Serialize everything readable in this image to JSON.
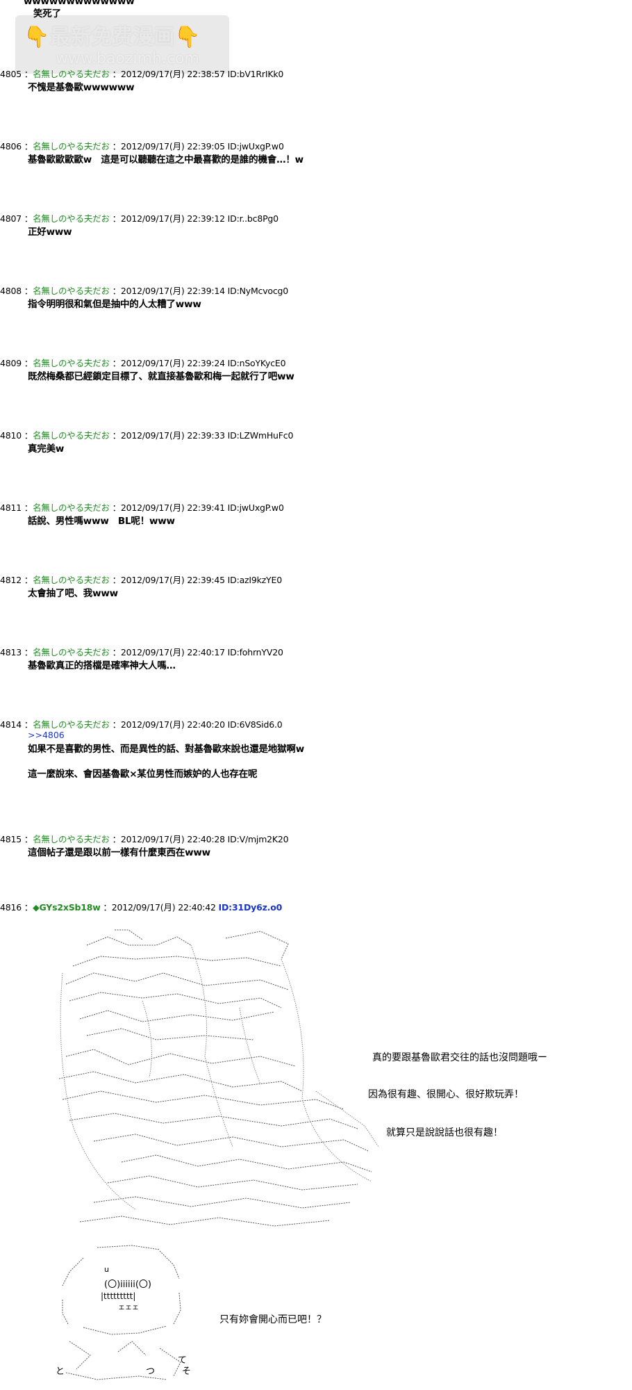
{
  "watermark": {
    "title": "最新免费漫画",
    "url": "www.baozimh.com",
    "hand": "👇"
  },
  "top_fragment": {
    "line1": "wwwwwwwwwwwww",
    "line2": "笑死了"
  },
  "posts": [
    {
      "num": "4805",
      "name": "名無しのやる夫だお",
      "date": "2012/09/17(月) 22:38:57",
      "id": "ID:bV1RrIKk0",
      "lines": [
        "不愧是基魯歐wwwwww"
      ]
    },
    {
      "num": "4806",
      "name": "名無しのやる夫だお",
      "date": "2012/09/17(月) 22:39:05",
      "id": "ID:jwUxgP.w0",
      "lines": [
        "基魯歐歐歐歐w　這是可以聽聽在這之中最喜歡的是誰的機會…！w"
      ]
    },
    {
      "num": "4807",
      "name": "名無しのやる夫だお",
      "date": "2012/09/17(月) 22:39:12",
      "id": "ID:r..bc8Pg0",
      "lines": [
        "正好www"
      ]
    },
    {
      "num": "4808",
      "name": "名無しのやる夫だお",
      "date": "2012/09/17(月) 22:39:14",
      "id": "ID:NyMcvocg0",
      "lines": [
        "指令明明很和氣但是抽中的人太糟了www"
      ]
    },
    {
      "num": "4809",
      "name": "名無しのやる夫だお",
      "date": "2012/09/17(月) 22:39:24",
      "id": "ID:nSoYKycE0",
      "lines": [
        "既然梅桑都已經鎖定目標了、就直接基魯歐和梅一起就行了吧ww"
      ]
    },
    {
      "num": "4810",
      "name": "名無しのやる夫だお",
      "date": "2012/09/17(月) 22:39:33",
      "id": "ID:LZWmHuFc0",
      "lines": [
        "真完美w"
      ]
    },
    {
      "num": "4811",
      "name": "名無しのやる夫だお",
      "date": "2012/09/17(月) 22:39:41",
      "id": "ID:jwUxgP.w0",
      "lines": [
        "話說、男性嗎www　BL呢！www"
      ]
    },
    {
      "num": "4812",
      "name": "名無しのやる夫だお",
      "date": "2012/09/17(月) 22:39:45",
      "id": "ID:azI9kzYE0",
      "lines": [
        "太會抽了吧、我www"
      ]
    },
    {
      "num": "4813",
      "name": "名無しのやる夫だお",
      "date": "2012/09/17(月) 22:40:17",
      "id": "ID:fohrnYV20",
      "lines": [
        "基魯歐真正的搭檔是確率神大人嗎…"
      ]
    },
    {
      "num": "4814",
      "name": "名無しのやる夫だお",
      "date": "2012/09/17(月) 22:40:20",
      "id": "ID:6V8Sid6.0",
      "anchor": ">>4806",
      "lines": [
        "如果不是喜歡的男性、而是異性的話、對基魯歐來說也還是地獄啊w",
        "這一麼說來、會因基魯歐×某位男性而嫉妒的人也存在呢"
      ]
    },
    {
      "num": "4815",
      "name": "名無しのやる夫だお",
      "date": "2012/09/17(月) 22:40:28",
      "id": "ID:V/mjm2K20",
      "lines": [
        "這個帖子還是跟以前一樣有什麼東西在www"
      ]
    }
  ],
  "final_post": {
    "num": "4816",
    "trip": "◆GYs2xSb18w",
    "date": "2012/09/17(月) 22:40:42",
    "id": "ID:31Dy6z.o0",
    "speech": [
      "真的要跟基魯歐君交往的話也沒問題哦ー",
      "因為很有趣、很開心、很好欺玩弄！",
      "就算只是說說話也很有趣！"
    ],
    "speech2": "只有妳會開心而已吧！？",
    "aa2_text": [
      "(〇)iiiiii(〇)",
      "u",
      "|ttttttttt|",
      "ェェェ",
      "て",
      "そ",
      "つ",
      "と"
    ]
  }
}
